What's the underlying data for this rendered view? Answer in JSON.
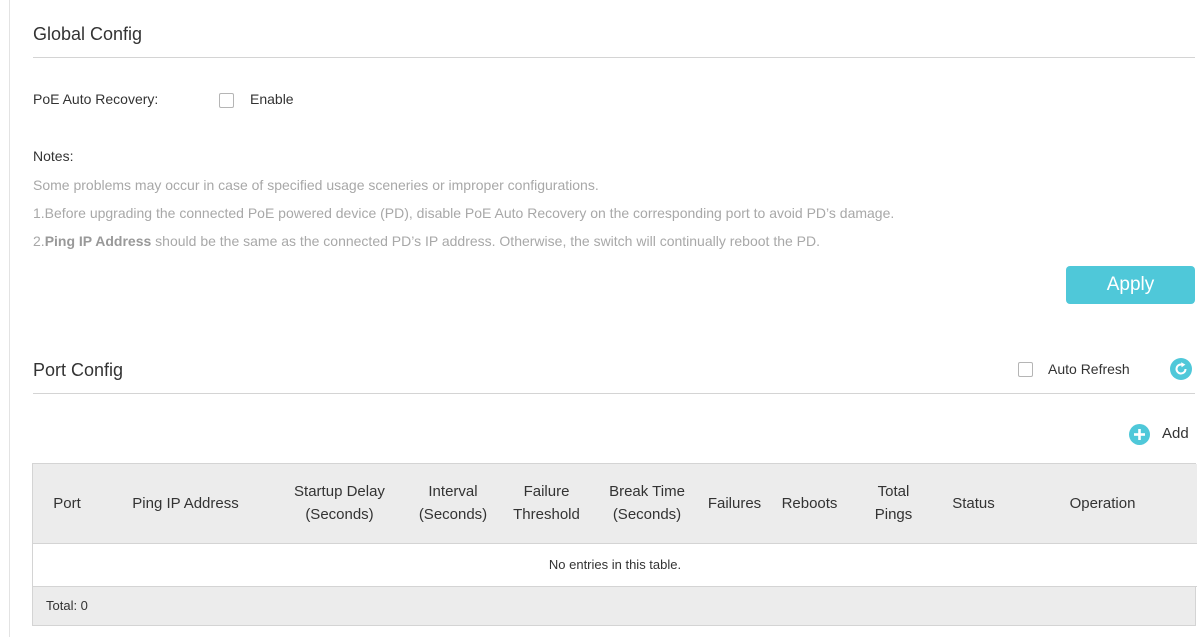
{
  "global_config": {
    "title": "Global Config",
    "poe_auto_recovery_label": "PoE Auto Recovery:",
    "enable_label": "Enable",
    "enable_checked": false,
    "notes_title": "Notes:",
    "note_intro": "Some problems may occur in case of specified usage sceneries or improper configurations.",
    "note_1": "1.Before upgrading the connected PoE powered device (PD), disable PoE Auto Recovery on the corresponding port to avoid PD’s damage.",
    "note_2_prefix": "2.",
    "note_2_bold": "Ping IP Address",
    "note_2_rest": " should be the same as the connected PD’s IP address. Otherwise, the switch will continually reboot the PD.",
    "apply_label": "Apply"
  },
  "port_config": {
    "title": "Port Config",
    "auto_refresh_label": "Auto Refresh",
    "auto_refresh_checked": false,
    "refresh_icon": "refresh-icon",
    "add_icon": "plus-circle-icon",
    "add_label": "Add",
    "table": {
      "columns": [
        {
          "l1": "Port",
          "l2": ""
        },
        {
          "l1": "Ping IP Address",
          "l2": ""
        },
        {
          "l1": "Startup Delay",
          "l2": "(Seconds)"
        },
        {
          "l1": "Interval",
          "l2": "(Seconds)"
        },
        {
          "l1": "Failure",
          "l2": "Threshold"
        },
        {
          "l1": "Break Time",
          "l2": "(Seconds)"
        },
        {
          "l1": "Failures",
          "l2": ""
        },
        {
          "l1": "Reboots",
          "l2": ""
        },
        {
          "l1": "Total",
          "l2": "Pings"
        },
        {
          "l1": "Status",
          "l2": ""
        },
        {
          "l1": "Operation",
          "l2": ""
        }
      ],
      "empty_message": "No entries in this table.",
      "total_label": "Total: 0"
    }
  },
  "colors": {
    "accent": "#4fc8d9",
    "note_text": "#a8a8a8",
    "header_bg": "#ececec"
  }
}
